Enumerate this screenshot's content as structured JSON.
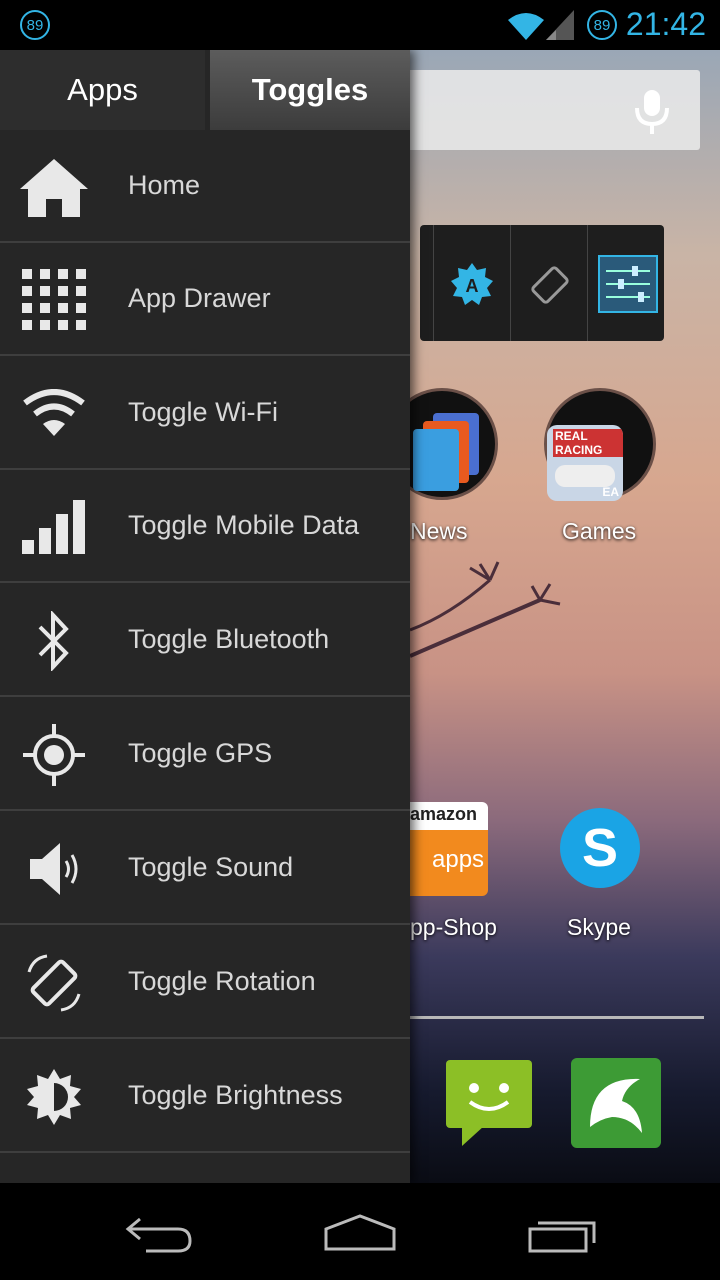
{
  "status_bar": {
    "left_badge": "89",
    "battery_badge": "89",
    "time": "21:42"
  },
  "drawer": {
    "tabs": [
      {
        "label": "Apps",
        "active": false
      },
      {
        "label": "Toggles",
        "active": true
      }
    ],
    "items": [
      {
        "label": "Home",
        "icon": "home-icon"
      },
      {
        "label": "App Drawer",
        "icon": "app-grid-icon"
      },
      {
        "label": "Toggle Wi-Fi",
        "icon": "wifi-icon"
      },
      {
        "label": "Toggle Mobile Data",
        "icon": "signal-bars-icon"
      },
      {
        "label": "Toggle Bluetooth",
        "icon": "bluetooth-icon"
      },
      {
        "label": "Toggle GPS",
        "icon": "gps-icon"
      },
      {
        "label": "Toggle Sound",
        "icon": "speaker-icon"
      },
      {
        "label": "Toggle Rotation",
        "icon": "rotation-icon"
      },
      {
        "label": "Toggle Brightness",
        "icon": "brightness-icon"
      }
    ]
  },
  "home": {
    "apps": [
      {
        "label": "News"
      },
      {
        "label": "Games"
      },
      {
        "label": "pp-Shop"
      },
      {
        "label": "Skype"
      }
    ],
    "amazon_badge": "amazon",
    "amazon_apps": "apps",
    "games_badge": "REAL RACING",
    "games_ea": "EA"
  },
  "colors": {
    "accent": "#33b5e5",
    "drawer_bg": "#262626"
  }
}
